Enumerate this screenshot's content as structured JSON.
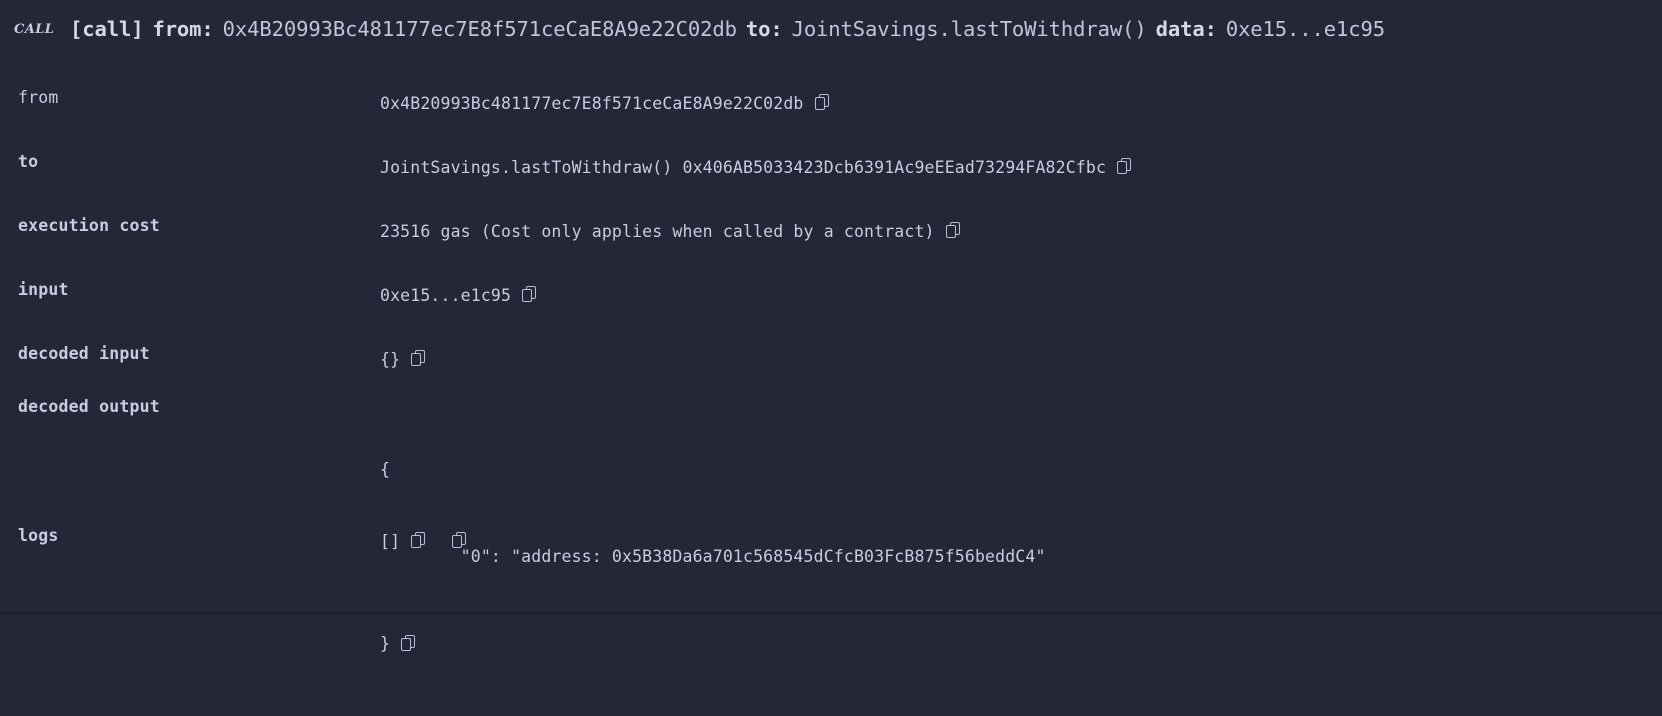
{
  "panel": {
    "background_color": "#242738",
    "text_color": "#c9cbe0",
    "badge": "CALL"
  },
  "summary": {
    "call_tag": "[call]",
    "from_label": "from:",
    "from_value": "0x4B20993Bc481177ec7E8f571ceCaE8A9e22C02db",
    "to_label": "to:",
    "to_value": "JointSavings.lastToWithdraw()",
    "data_label": "data:",
    "data_value": "0xe15...e1c95"
  },
  "rows": [
    {
      "label": "from",
      "value": "0x4B20993Bc481177ec7E8f571ceCaE8A9e22C02db",
      "copy_icon": "copy-icon"
    },
    {
      "label": "to",
      "value": "JointSavings.lastToWithdraw() 0x406AB5033423Dcb6391Ac9eEEad73294FA82Cfbc",
      "copy_icon": "copy-icon"
    },
    {
      "label": "execution cost",
      "value": "23516 gas (Cost only applies when called by a contract)",
      "copy_icon": "copy-icon"
    },
    {
      "label": "input",
      "value": "0xe15...e1c95",
      "copy_icon": "copy-icon"
    },
    {
      "label": "decoded input",
      "value": "{}",
      "copy_icon": "copy-icon"
    },
    {
      "label": "decoded output",
      "line1": "{",
      "line2": "        \"0\": \"address: 0x5B38Da6a701c568545dCfcB03FcB875f56beddC4\"",
      "line3": "}",
      "copy_icon": "copy-icon"
    },
    {
      "label": "logs",
      "value": "[]",
      "copy_icon": "copy-icon",
      "copy_icon_2": "copy-icon"
    }
  ]
}
